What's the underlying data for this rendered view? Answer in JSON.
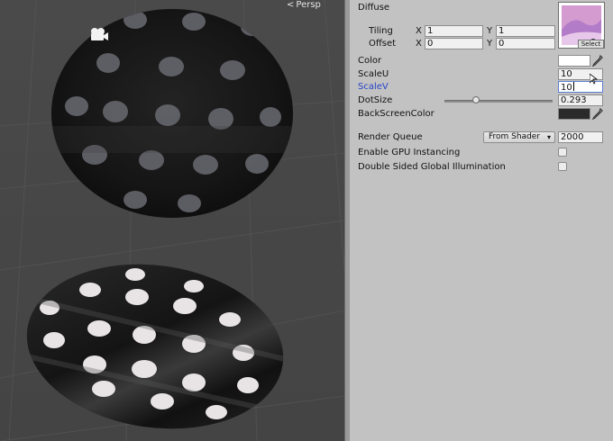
{
  "scene": {
    "view_mode": "Persp",
    "icons": {
      "camera": "camera-gizmo-icon",
      "view_arrow": "chevron-left-icon"
    }
  },
  "inspector": {
    "diffuse": {
      "label": "Diffuse",
      "select_label": "Select",
      "tiling": {
        "label": "Tiling",
        "x_axis": "X",
        "x": "1",
        "y_axis": "Y",
        "y": "1"
      },
      "offset": {
        "label": "Offset",
        "x_axis": "X",
        "x": "0",
        "y_axis": "Y",
        "y": "0"
      }
    },
    "color": {
      "label": "Color",
      "value_hex": "#ffffff"
    },
    "scale_u": {
      "label": "ScaleU",
      "value": "10"
    },
    "scale_v": {
      "label": "ScaleV",
      "value": "10",
      "focused": true
    },
    "dot_size": {
      "label": "DotSize",
      "value": "0.293",
      "slider_fraction": 0.293
    },
    "back_screen_color": {
      "label": "BackScreenColor",
      "value_hex": "#2a2a2a"
    },
    "render_queue": {
      "label": "Render Queue",
      "dropdown": "From Shader",
      "value": "2000"
    },
    "gpu_instancing": {
      "label": "Enable GPU Instancing",
      "checked": false
    },
    "double_sided_gi": {
      "label": "Double Sided Global Illumination",
      "checked": false
    }
  },
  "colors": {
    "accent_label": "#2743c7",
    "panel_bg": "#c2c2c2",
    "scene_bg": "#474747"
  }
}
